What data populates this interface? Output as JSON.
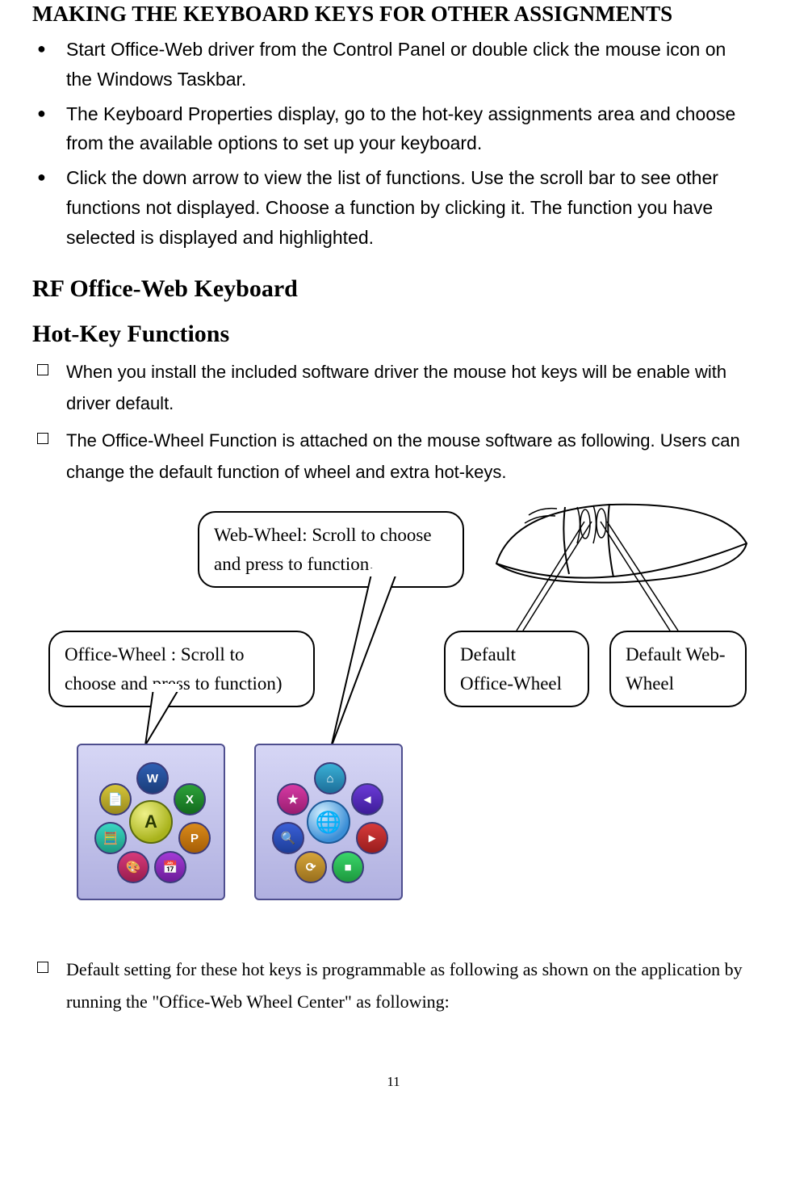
{
  "headings": {
    "main": "MAKING THE KEYBOARD KEYS FOR OTHER ASSIGNMENTS",
    "sub1": "RF Office-Web Keyboard",
    "sub2": "Hot-Key Functions"
  },
  "bullets_top": [
    "Start Office-Web driver from the Control Panel or double click the mouse icon on the Windows Taskbar.",
    "The Keyboard Properties display, go to the hot-key assignments area and choose from the available options to set up your keyboard.",
    "Click the down arrow to view the list of functions. Use the scroll bar to see other functions not displayed. Choose a function by clicking it. The function you have selected is displayed and highlighted."
  ],
  "bullets_mid": [
    "When you install the included software driver the mouse hot keys will be enable with driver default.",
    "The Office-Wheel Function is attached on the mouse software as following. Users can change the default function of wheel and extra hot-keys."
  ],
  "bullets_bottom": [
    "Default setting for these hot keys is programmable as following as shown on the application by running the \"Office-Web Wheel Center\" as following:"
  ],
  "callouts": {
    "web_wheel": "Web-Wheel: Scroll to choose and press to function.",
    "office_wheel": "Office-Wheel : Scroll to choose and press to function)",
    "default_office": "Default Office-Wheel",
    "default_web": "Default Web-Wheel"
  },
  "radial_center": {
    "a_letter": "A",
    "b_letter": ""
  },
  "page_number": "11"
}
